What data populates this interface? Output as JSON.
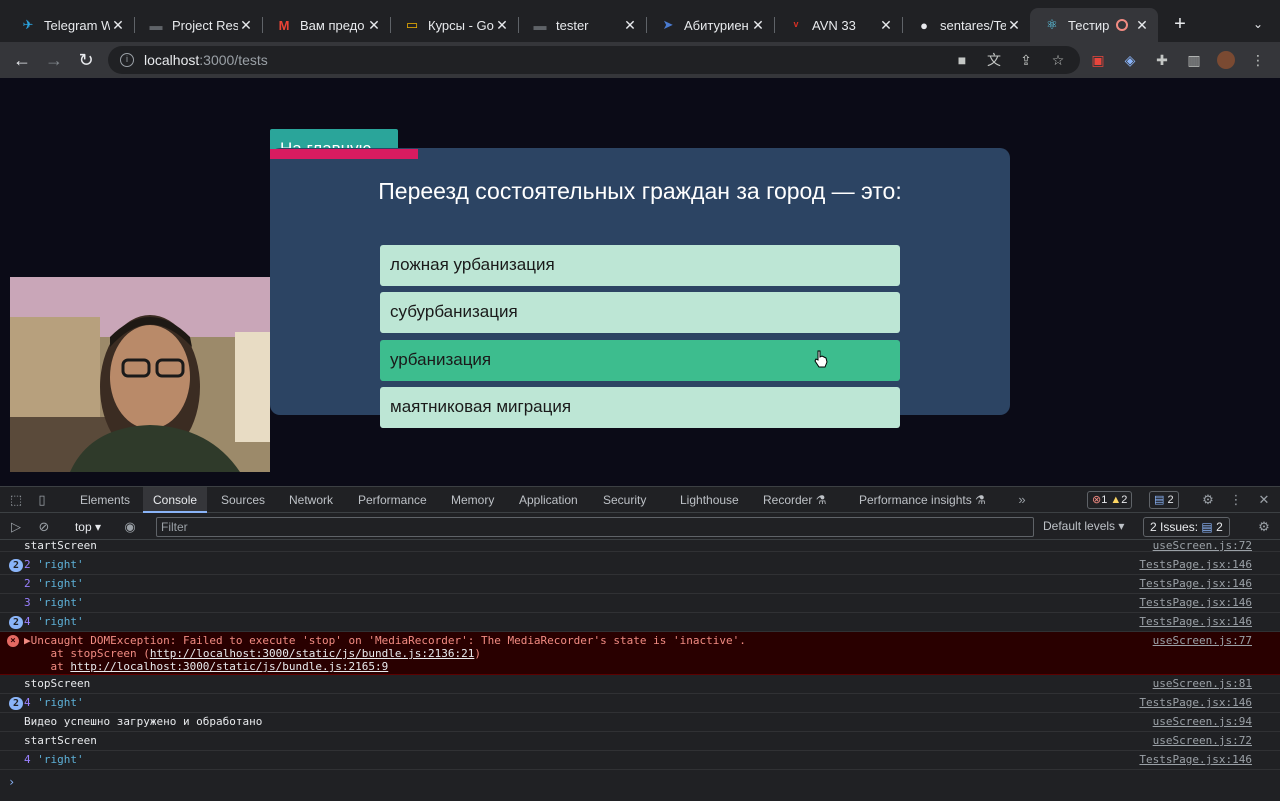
{
  "browser": {
    "tabs": [
      {
        "title": "Telegram W",
        "favicon": "telegram-icon",
        "color": "#2aa3df",
        "glyph": "✈"
      },
      {
        "title": "Project Res",
        "favicon": "monitor-icon",
        "color": "#5f6368",
        "glyph": "▬"
      },
      {
        "title": "Вам предо",
        "favicon": "gmail-icon",
        "color": "#ea4335",
        "glyph": "M"
      },
      {
        "title": "Курсы - Go",
        "favicon": "classroom-icon",
        "color": "#f4b400",
        "glyph": "▭"
      },
      {
        "title": "tester",
        "favicon": "monitor-icon",
        "color": "#5f6368",
        "glyph": "▬"
      },
      {
        "title": "Абитуриен",
        "favicon": "bird-icon",
        "color": "#4a7bd0",
        "glyph": "➤"
      },
      {
        "title": "AVN 33",
        "favicon": "avn-icon",
        "color": "#d93025",
        "glyph": "ᵛ"
      },
      {
        "title": "sentares/Te",
        "favicon": "github-icon",
        "color": "#e8eaed",
        "glyph": "●"
      },
      {
        "title": "Тестир",
        "favicon": "react-icon",
        "color": "#61dafb",
        "glyph": "⚛",
        "active": true
      }
    ],
    "url": {
      "host": "localhost",
      "path": ":3000/tests"
    }
  },
  "page": {
    "home_button": "На главную",
    "question": "Переезд состоятельных граждан за город — это:",
    "answers": [
      {
        "label": "ложная урбанизация"
      },
      {
        "label": "субурбанизация"
      },
      {
        "label": "урбанизация",
        "selected": true
      },
      {
        "label": "маятниковая миграция"
      }
    ],
    "progress_fraction": 0.2,
    "accent_color": "#3dbd8e",
    "card_color": "#2c4463"
  },
  "devtools": {
    "tabs": [
      "Elements",
      "Console",
      "Sources",
      "Network",
      "Performance",
      "Memory",
      "Application",
      "Security",
      "Lighthouse",
      "Recorder",
      "Performance insights"
    ],
    "active_tab": "Console",
    "counts": {
      "errors": "1",
      "warnings": "2",
      "messages": "2"
    },
    "context": "top",
    "filter_placeholder": "Filter",
    "levels": "Default levels",
    "issues": "2 Issues:",
    "issues_count": "2",
    "logs": [
      {
        "text": "startScreen",
        "source": "useScreen.js:72"
      },
      {
        "count": "2",
        "num": "2",
        "str": "'right'",
        "source": "TestsPage.jsx:146"
      },
      {
        "num": "2",
        "str": "'right'",
        "source": "TestsPage.jsx:146"
      },
      {
        "num": "3",
        "str": "'right'",
        "source": "TestsPage.jsx:146"
      },
      {
        "count": "2",
        "num": "4",
        "str": "'right'",
        "source": "TestsPage.jsx:146"
      },
      {
        "error": true,
        "text": "▶Uncaught DOMException: Failed to execute 'stop' on 'MediaRecorder': The MediaRecorder's state is 'inactive'.",
        "line2_prefix": "    at stopScreen (",
        "line2_link": "http://localhost:3000/static/js/bundle.js:2136:21",
        "line2_suffix": ")",
        "line3_prefix": "    at ",
        "line3_link": "http://localhost:3000/static/js/bundle.js:2165:9",
        "source": "useScreen.js:77"
      },
      {
        "text": "stopScreen",
        "source": "useScreen.js:81"
      },
      {
        "count": "2",
        "num": "4",
        "str": "'right'",
        "source": "TestsPage.jsx:146"
      },
      {
        "text": "Видео успешно загружено и обработано",
        "source": "useScreen.js:94"
      },
      {
        "text": "startScreen",
        "source": "useScreen.js:72"
      },
      {
        "num": "4",
        "str": "'right'",
        "source": "TestsPage.jsx:146"
      }
    ]
  }
}
